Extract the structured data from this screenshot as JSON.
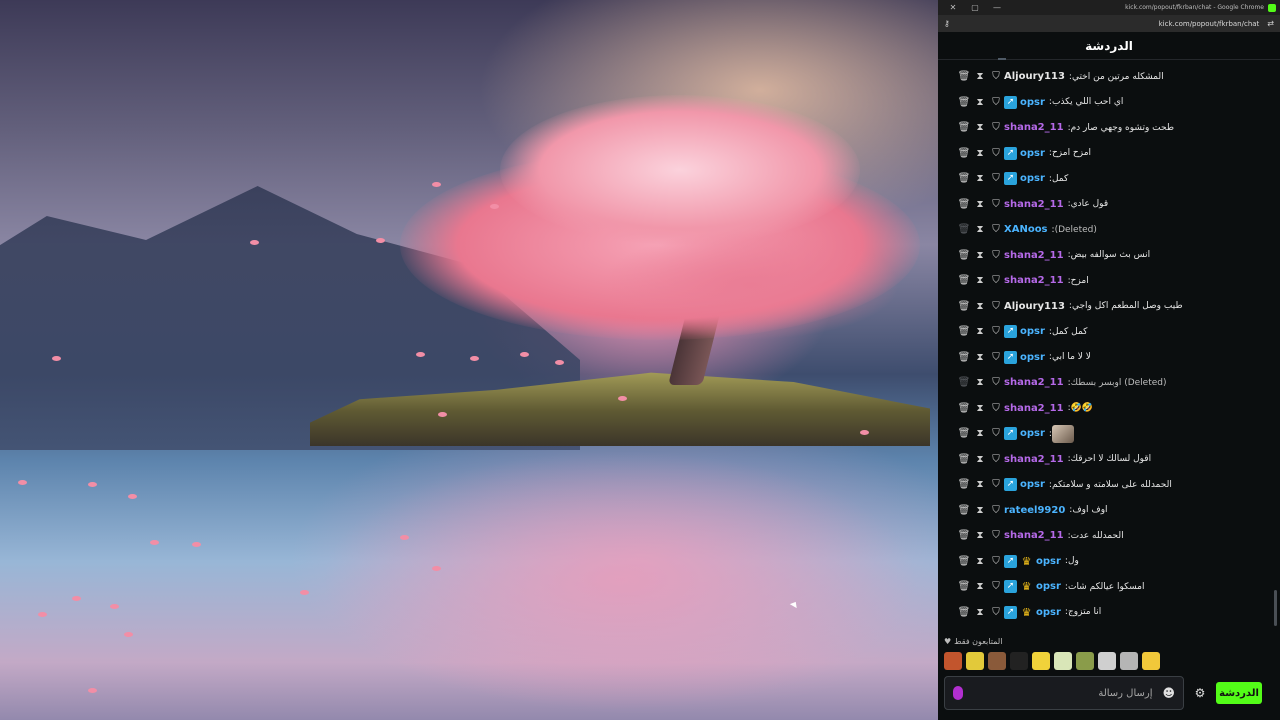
{
  "window": {
    "title": "kick.com/popout/fkrban/chat - Google Chrome",
    "url": "kick.com/popout/fkrban/chat"
  },
  "chat": {
    "header_title": "الدردشة",
    "messages": [
      {
        "user": "Aljoury113",
        "color": "#e6e6e6",
        "badges": [],
        "text": "المشكله مرتين من اختي",
        "deleted": false
      },
      {
        "user": "opsr",
        "color": "#4bb4ff",
        "badges": [
          "pro"
        ],
        "text": "اي احب اللي يكذب",
        "deleted": false
      },
      {
        "user": "shana2_11",
        "color": "#b569e8",
        "badges": [],
        "text": "طحت وتشوه وجهي صار دم",
        "deleted": false
      },
      {
        "user": "opsr",
        "color": "#4bb4ff",
        "badges": [
          "pro"
        ],
        "text": "امزح امزح",
        "deleted": false
      },
      {
        "user": "opsr",
        "color": "#4bb4ff",
        "badges": [
          "pro"
        ],
        "text": "كمل",
        "deleted": false
      },
      {
        "user": "shana2_11",
        "color": "#b569e8",
        "badges": [],
        "text": "قول عادي",
        "deleted": false
      },
      {
        "user": "XANoos",
        "color": "#4bb4ff",
        "badges": [],
        "text": "(Deleted)",
        "deleted": true
      },
      {
        "user": "shana2_11",
        "color": "#b569e8",
        "badges": [],
        "text": "انس بث سوالفه بيض",
        "deleted": false
      },
      {
        "user": "shana2_11",
        "color": "#b569e8",
        "badges": [],
        "text": "امزح",
        "deleted": false
      },
      {
        "user": "Aljoury113",
        "color": "#e6e6e6",
        "badges": [],
        "text": "طيب وصل المطعم اكل واجي",
        "deleted": false
      },
      {
        "user": "opsr",
        "color": "#4bb4ff",
        "badges": [
          "pro"
        ],
        "text": "كمل كمل",
        "deleted": false
      },
      {
        "user": "opsr",
        "color": "#4bb4ff",
        "badges": [
          "pro"
        ],
        "text": "لا لا ما ابي",
        "deleted": false
      },
      {
        "user": "shana2_11",
        "color": "#b569e8",
        "badges": [],
        "text": "اوبسر بسطك (Deleted)",
        "deleted": true
      },
      {
        "user": "shana2_11",
        "color": "#b569e8",
        "badges": [],
        "text": "🤣🤣",
        "deleted": false
      },
      {
        "user": "opsr",
        "color": "#4bb4ff",
        "badges": [
          "pro"
        ],
        "text": "",
        "emote": true,
        "deleted": false
      },
      {
        "user": "shana2_11",
        "color": "#b569e8",
        "badges": [],
        "text": "اقول لسالك لا احرقك",
        "deleted": false
      },
      {
        "user": "opsr",
        "color": "#4bb4ff",
        "badges": [
          "pro"
        ],
        "text": "الحمدلله على سلامته و سلامتكم",
        "deleted": false
      },
      {
        "user": "rateel9920",
        "color": "#4bb4ff",
        "badges": [],
        "text": "اوف اوف",
        "deleted": false
      },
      {
        "user": "shana2_11",
        "color": "#b569e8",
        "badges": [],
        "text": "الحمدلله عدت",
        "deleted": false
      },
      {
        "user": "opsr",
        "color": "#4bb4ff",
        "badges": [
          "pro",
          "crown"
        ],
        "text": "ول",
        "deleted": false
      },
      {
        "user": "opsr",
        "color": "#4bb4ff",
        "badges": [
          "pro",
          "crown"
        ],
        "text": "امسكوا عيالكم شات",
        "deleted": false
      },
      {
        "user": "opsr",
        "color": "#4bb4ff",
        "badges": [
          "pro",
          "crown"
        ],
        "text": "انا متزوج",
        "deleted": false
      }
    ],
    "followers_only_label": "المتابعون فقط",
    "emote_colors": [
      "#c2552d",
      "#e2c93a",
      "#8a5a3a",
      "#222222",
      "#f0d23a",
      "#d9e6b8",
      "#8a9c4a",
      "#cfcfcf",
      "#b5b5b5",
      "#f1c83a"
    ],
    "input_placeholder": "إرسال رسالة",
    "send_label": "الدردشة",
    "accent": "#53fc18"
  }
}
